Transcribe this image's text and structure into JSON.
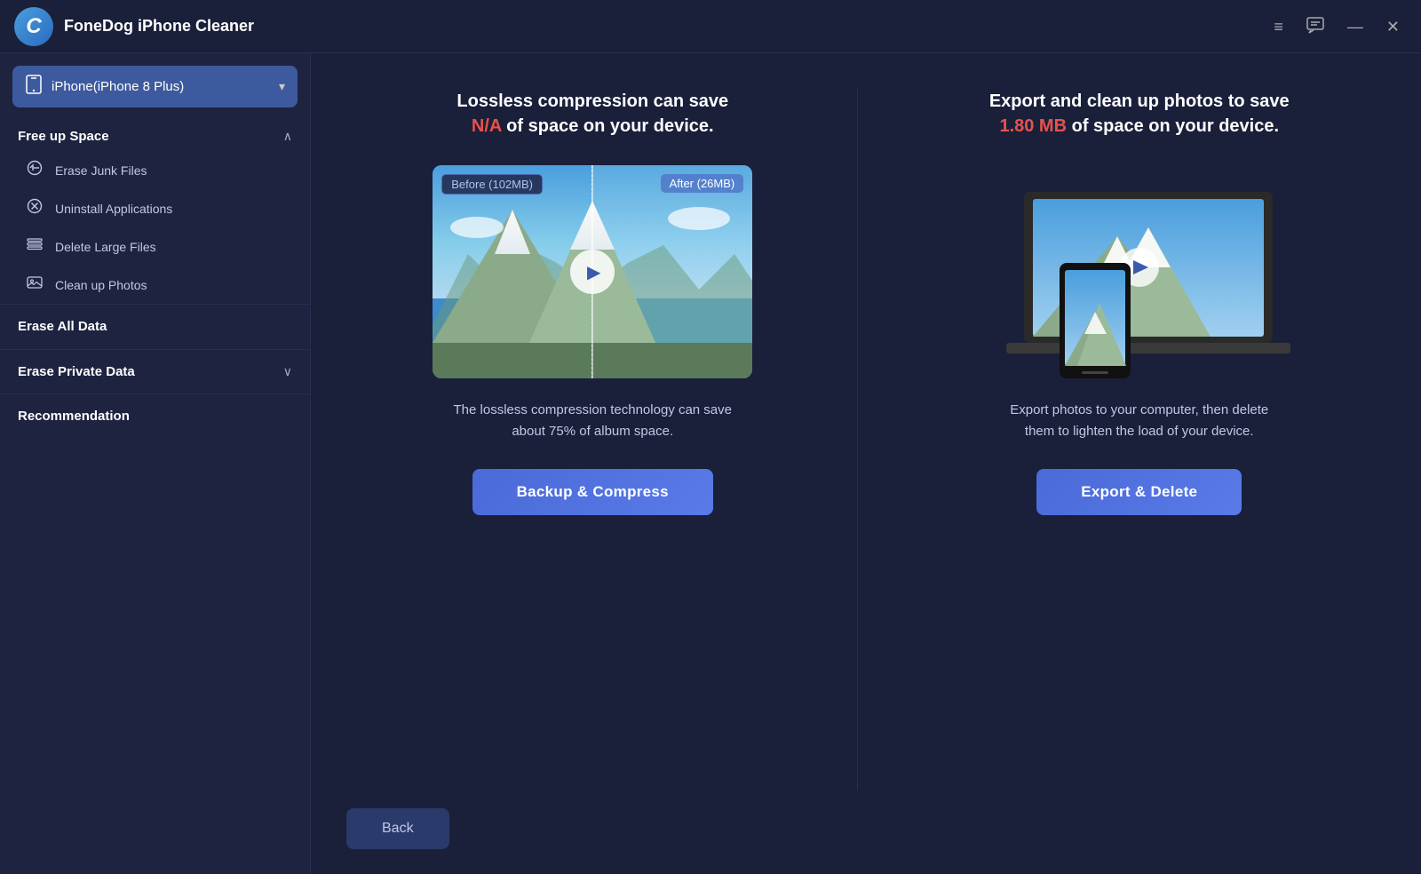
{
  "app": {
    "logo": "C",
    "title": "FoneDog iPhone Cleaner"
  },
  "titlebar": {
    "menu_icon": "≡",
    "chat_icon": "💬",
    "minimize_icon": "—",
    "close_icon": "✕"
  },
  "sidebar": {
    "device": {
      "name": "iPhone(iPhone 8 Plus)",
      "icon": "📱"
    },
    "sections": [
      {
        "title": "Free up Space",
        "collapsible": true,
        "expanded": true,
        "items": [
          {
            "label": "Erase Junk Files",
            "icon": "⏱"
          },
          {
            "label": "Uninstall Applications",
            "icon": "⊗"
          },
          {
            "label": "Delete Large Files",
            "icon": "☰"
          },
          {
            "label": "Clean up Photos",
            "icon": "🖼"
          }
        ]
      }
    ],
    "simple_items": [
      {
        "title": "Erase All Data"
      },
      {
        "title": "Erase Private Data",
        "collapsible": true
      },
      {
        "title": "Recommendation"
      }
    ]
  },
  "left_panel": {
    "title_part1": "Lossless compression can save",
    "title_highlight": "N/A",
    "title_part2": "of space on your device.",
    "before_label": "Before (102MB)",
    "after_label": "After (26MB)",
    "description": "The lossless compression technology can save about 75% of album space.",
    "button_label": "Backup & Compress"
  },
  "right_panel": {
    "title_part1": "Export and clean up photos to save",
    "title_highlight": "1.80 MB",
    "title_part2": "of space on your device.",
    "description": "Export photos to your computer, then delete them to lighten the load of your device.",
    "button_label": "Export & Delete"
  },
  "bottom": {
    "back_label": "Back"
  }
}
